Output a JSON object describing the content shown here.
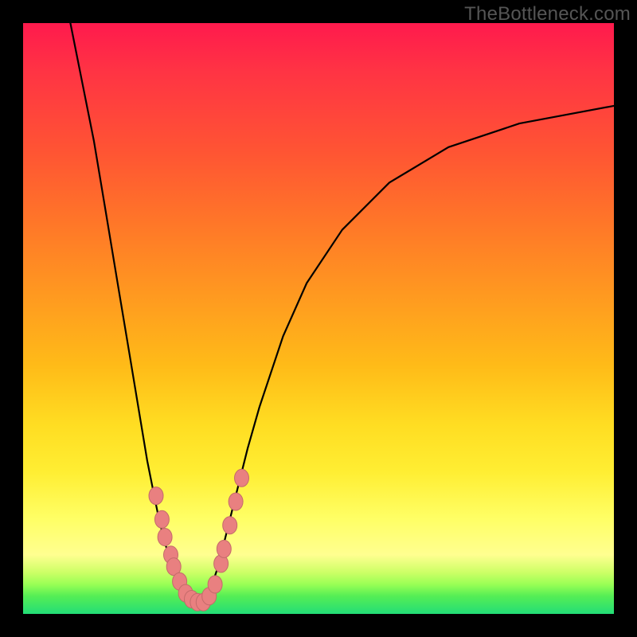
{
  "watermark": "TheBottleneck.com",
  "colors": {
    "frame": "#000000",
    "curve": "#000000",
    "bead_fill": "#e98080",
    "bead_stroke": "#c46a6a"
  },
  "chart_data": {
    "type": "line",
    "title": "",
    "xlabel": "",
    "ylabel": "",
    "xlim": [
      0,
      100
    ],
    "ylim": [
      0,
      100
    ],
    "series": [
      {
        "name": "left-curve",
        "x": [
          8,
          10,
          12,
          14,
          16,
          18,
          20,
          21,
          22,
          23,
          24,
          25,
          26,
          27,
          28,
          29,
          30
        ],
        "y": [
          100,
          90,
          80,
          68,
          56,
          44,
          32,
          26,
          21,
          16,
          12,
          9,
          6,
          4,
          3,
          2,
          2
        ]
      },
      {
        "name": "right-curve",
        "x": [
          30,
          31,
          32,
          33,
          34,
          35,
          36,
          38,
          40,
          44,
          48,
          54,
          62,
          72,
          84,
          100
        ],
        "y": [
          2,
          3,
          5,
          8,
          12,
          16,
          20,
          28,
          35,
          47,
          56,
          65,
          73,
          79,
          83,
          86
        ]
      }
    ],
    "beads": [
      {
        "x": 22.5,
        "y": 20
      },
      {
        "x": 23.5,
        "y": 16
      },
      {
        "x": 24.0,
        "y": 13
      },
      {
        "x": 25.0,
        "y": 10
      },
      {
        "x": 25.5,
        "y": 8
      },
      {
        "x": 26.5,
        "y": 5.5
      },
      {
        "x": 27.5,
        "y": 3.5
      },
      {
        "x": 28.5,
        "y": 2.5
      },
      {
        "x": 29.5,
        "y": 2
      },
      {
        "x": 30.5,
        "y": 2
      },
      {
        "x": 31.5,
        "y": 3
      },
      {
        "x": 32.5,
        "y": 5
      },
      {
        "x": 33.5,
        "y": 8.5
      },
      {
        "x": 34.0,
        "y": 11
      },
      {
        "x": 35.0,
        "y": 15
      },
      {
        "x": 36.0,
        "y": 19
      },
      {
        "x": 37.0,
        "y": 23
      }
    ]
  }
}
